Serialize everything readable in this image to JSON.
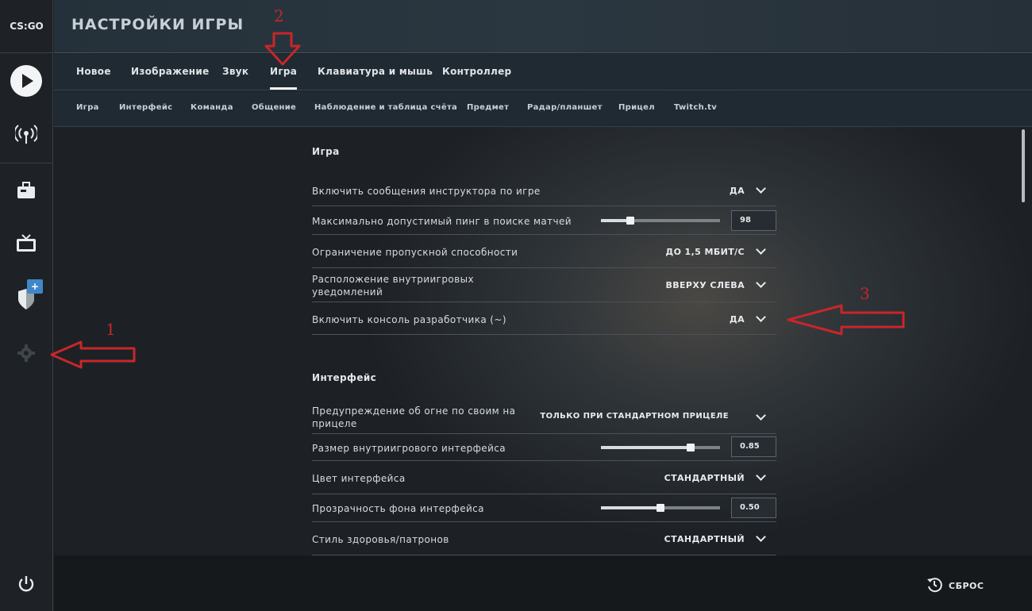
{
  "app": {
    "logo": "CS:GO"
  },
  "header": {
    "title": "НАСТРОЙКИ ИГРЫ"
  },
  "tabs": [
    {
      "label": "Новое"
    },
    {
      "label": "Изображение"
    },
    {
      "label": "Звук"
    },
    {
      "label": "Игра",
      "active": true
    },
    {
      "label": "Клавиатура и мышь"
    },
    {
      "label": "Контроллер"
    }
  ],
  "subtabs": [
    {
      "label": "Игра"
    },
    {
      "label": "Интерфейс"
    },
    {
      "label": "Команда"
    },
    {
      "label": "Общение"
    },
    {
      "label": "Наблюдение и таблица счёта"
    },
    {
      "label": "Предмет"
    },
    {
      "label": "Радар/планшет"
    },
    {
      "label": "Прицел"
    },
    {
      "label": "Twitch.tv"
    }
  ],
  "sections": {
    "game": {
      "title": "Игра",
      "rows": [
        {
          "label": "Включить сообщения инструктора по игре",
          "value": "ДА"
        },
        {
          "label": "Максимально допустимый пинг в поиске матчей",
          "value": "98",
          "slider_fraction": 0.25
        },
        {
          "label": "Ограничение пропускной способности",
          "value": "ДО 1,5 МБИТ/С"
        },
        {
          "label": "Расположение внутриигровых уведомлений",
          "value": "ВВЕРХУ СЛЕВА"
        },
        {
          "label": "Включить консоль разработчика (~)",
          "value": "ДА"
        }
      ]
    },
    "interface": {
      "title": "Интерфейс",
      "rows": [
        {
          "label": "Предупреждение об огне по своим на прицеле",
          "value": "ТОЛЬКО ПРИ СТАНДАРТНОМ ПРИЦЕЛЕ"
        },
        {
          "label": "Размер внутриигрового интерфейса",
          "value": "0.85",
          "slider_fraction": 0.75
        },
        {
          "label": "Цвет интерфейса",
          "value": "СТАНДАРТНЫЙ"
        },
        {
          "label": "Прозрачность фона интерфейса",
          "value": "0.50",
          "slider_fraction": 0.5
        },
        {
          "label": "Стиль здоровья/патронов",
          "value": "СТАНДАРТНЫЙ"
        }
      ]
    }
  },
  "footer": {
    "reset_label": "СБРОС"
  },
  "annotations": [
    "1",
    "2",
    "3"
  ],
  "colors": {
    "annotation": "#c8262a",
    "badge": "#3f87c9"
  },
  "icons": [
    "play-icon",
    "broadcast-icon",
    "briefcase-icon",
    "tv-icon",
    "shield-icon",
    "gear-icon",
    "power-icon",
    "reset-icon"
  ]
}
